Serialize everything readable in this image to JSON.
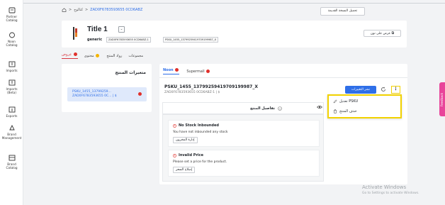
{
  "colors": {
    "accent": "#2f6fe8",
    "alert_red": "#e0302b",
    "highlight_yellow": "#f2d200",
    "pending_yellow": "#f4b400",
    "side_tab_pink": "#e8449a"
  },
  "nav": {
    "items": [
      {
        "icon": "partner-catalog-icon",
        "label1": "Partner",
        "label2": "Catalog"
      },
      {
        "icon": "noon-catalog-icon",
        "label1": "Noon",
        "label2": "Catalog"
      },
      {
        "icon": "imports-icon",
        "label1": "Imports",
        "label2": ""
      },
      {
        "icon": "imports-beta-icon",
        "label1": "Imports",
        "label2": "(Beta)"
      },
      {
        "icon": "exports-icon",
        "label1": "Exports",
        "label2": ""
      },
      {
        "icon": "brand-management-icon",
        "label1": "Brand",
        "label2": "Management"
      },
      {
        "icon": "brand-catalog-icon",
        "label1": "Brand",
        "label2": "Catalog"
      }
    ]
  },
  "breadcrumb": {
    "home_icon": "home-icon",
    "sep": ">",
    "catalog": "كتالوج",
    "current": "ZAD0F6783593655 0CD6ABZ"
  },
  "header": {
    "legacy_button": "تحميل النسخة القديمة",
    "title": "Title 1",
    "brand": "generic",
    "chip1": "ZAD0F6783593655 0CD6ABZ-1",
    "chip2": "PSKU_1455_13799259419709199987_X",
    "show_live_button": "عرض على نون"
  },
  "tabs": {
    "offers": "عروض",
    "content": "محتوى",
    "product_hub": "رواد المنتج",
    "groups": "مجموعات"
  },
  "variants": {
    "heading": "متغيرات المنتج",
    "card_line1": "PSKU_1455_13799259...",
    "card_line2": "ZAD0F6783593655 0C... | $"
  },
  "offers": {
    "tab_noon": "Noon",
    "tab_supermall": "Supermall",
    "psku": "PSKU_1455_13799259419709199987_X",
    "psku_sub": "ZAD0F6783593655 0CD6ABZ-1 | $",
    "share_button": "نشر التغييرات",
    "kebab": "⋮",
    "menu_edit": "تعديل PSKU",
    "menu_delete": "حذف المنتج",
    "details_title": "تفاصيل المنتج",
    "alert1_title": "No Stock Inbounded",
    "alert1_body": "You have not inbounded any stock",
    "alert1_button": "إدارة المخزون",
    "alert2_title": "Invalid Price",
    "alert2_body": "Please set a price for the product.",
    "alert2_button": "إصلاح السعر"
  },
  "watermark": {
    "line1": "Activate Windows",
    "line2": "Go to Settings to activate Windows."
  },
  "side_tab": {
    "label": "Feedback"
  }
}
